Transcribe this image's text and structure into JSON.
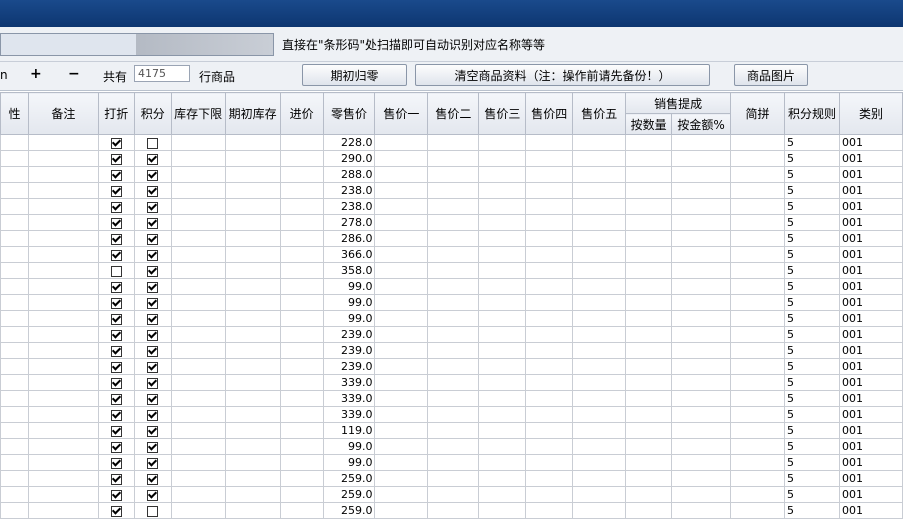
{
  "toolbar_top": {
    "hint": "直接在\"条形码\"处扫描即可自动识别对应名称等等"
  },
  "toolbar": {
    "left_partial": "n",
    "plus": "+",
    "minus": "−",
    "count_label": "共有",
    "count_value": "4175",
    "rows_label": "行商品",
    "btn_reset": "期初归零",
    "btn_clear": "清空商品资料（注：操作前请先备份！）",
    "btn_image": "商品图片"
  },
  "table": {
    "headers": {
      "attr": "性",
      "note": "备注",
      "discount": "打折",
      "points": "积分",
      "stock_min": "库存下限",
      "init_stock": "期初库存",
      "cost": "进价",
      "retail": "零售价",
      "p1": "售价一",
      "p2": "售价二",
      "p3": "售价三",
      "p4": "售价四",
      "p5": "售价五",
      "commission": "销售提成",
      "by_qty": "按数量",
      "by_amt": "按金额%",
      "pinyin": "简拼",
      "point_rule": "积分规则",
      "category": "类别"
    },
    "rows": [
      {
        "discount": true,
        "points": false,
        "retail": "228.0",
        "rule": "5",
        "cat": "001"
      },
      {
        "discount": true,
        "points": true,
        "retail": "290.0",
        "rule": "5",
        "cat": "001"
      },
      {
        "discount": true,
        "points": true,
        "retail": "288.0",
        "rule": "5",
        "cat": "001"
      },
      {
        "discount": true,
        "points": true,
        "retail": "238.0",
        "rule": "5",
        "cat": "001"
      },
      {
        "discount": true,
        "points": true,
        "retail": "238.0",
        "rule": "5",
        "cat": "001"
      },
      {
        "discount": true,
        "points": true,
        "retail": "278.0",
        "rule": "5",
        "cat": "001"
      },
      {
        "discount": true,
        "points": true,
        "retail": "286.0",
        "rule": "5",
        "cat": "001"
      },
      {
        "discount": true,
        "points": true,
        "retail": "366.0",
        "rule": "5",
        "cat": "001"
      },
      {
        "discount": false,
        "points": true,
        "retail": "358.0",
        "rule": "5",
        "cat": "001"
      },
      {
        "discount": true,
        "points": true,
        "retail": "99.0",
        "rule": "5",
        "cat": "001"
      },
      {
        "discount": true,
        "points": true,
        "retail": "99.0",
        "rule": "5",
        "cat": "001"
      },
      {
        "discount": true,
        "points": true,
        "retail": "99.0",
        "rule": "5",
        "cat": "001"
      },
      {
        "discount": true,
        "points": true,
        "retail": "239.0",
        "rule": "5",
        "cat": "001"
      },
      {
        "discount": true,
        "points": true,
        "retail": "239.0",
        "rule": "5",
        "cat": "001"
      },
      {
        "discount": true,
        "points": true,
        "retail": "239.0",
        "rule": "5",
        "cat": "001"
      },
      {
        "discount": true,
        "points": true,
        "retail": "339.0",
        "rule": "5",
        "cat": "001"
      },
      {
        "discount": true,
        "points": true,
        "retail": "339.0",
        "rule": "5",
        "cat": "001"
      },
      {
        "discount": true,
        "points": true,
        "retail": "339.0",
        "rule": "5",
        "cat": "001"
      },
      {
        "discount": true,
        "points": true,
        "retail": "119.0",
        "rule": "5",
        "cat": "001"
      },
      {
        "discount": true,
        "points": true,
        "retail": "99.0",
        "rule": "5",
        "cat": "001"
      },
      {
        "discount": true,
        "points": true,
        "retail": "99.0",
        "rule": "5",
        "cat": "001"
      },
      {
        "discount": true,
        "points": true,
        "retail": "259.0",
        "rule": "5",
        "cat": "001"
      },
      {
        "discount": true,
        "points": true,
        "retail": "259.0",
        "rule": "5",
        "cat": "001"
      },
      {
        "discount": true,
        "points": false,
        "retail": "259.0",
        "rule": "5",
        "cat": "001"
      }
    ]
  }
}
